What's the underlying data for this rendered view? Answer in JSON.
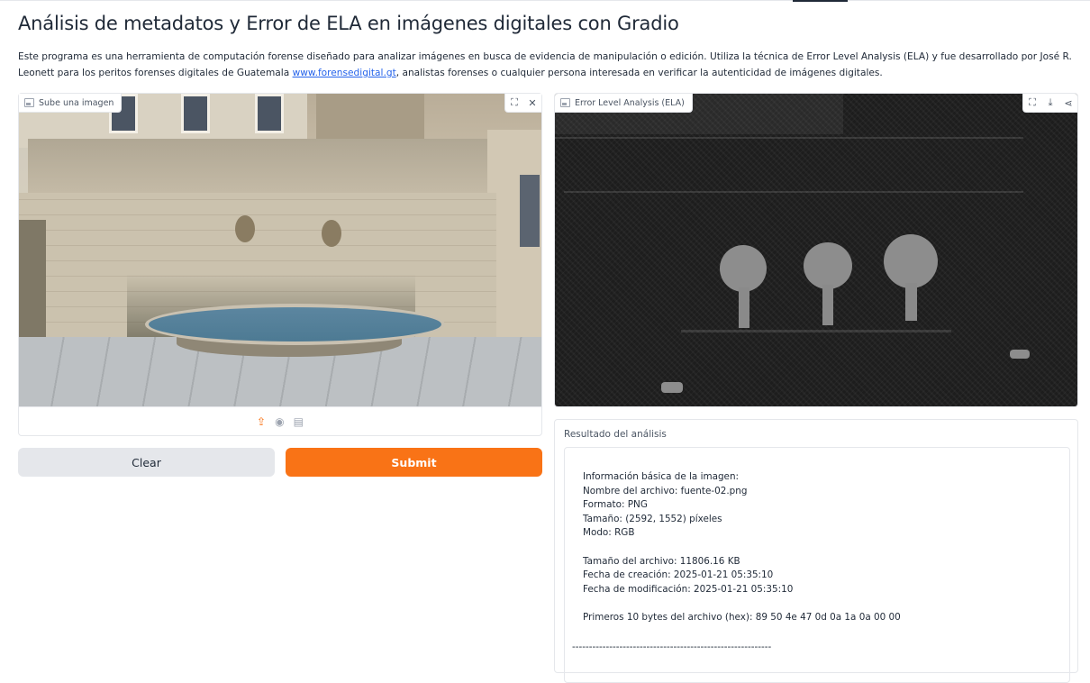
{
  "page": {
    "title": "Análisis de metadatos y Error de ELA en imágenes digitales con Gradio",
    "description_prefix": "Este programa es una herramienta de computación forense diseñado para analizar imágenes en busca de evidencia de manipulación o edición. Utiliza la técnica de Error Level Analysis (ELA) y fue desarrollado por José R. Leonett para los peritos forenses digitales de Guatemala ",
    "description_link": "www.forensedigital.gt",
    "description_suffix": ", analistas forenses o cualquier persona interesada en verificar la autenticidad de imágenes digitales."
  },
  "input_panel": {
    "label": "Sube una imagen",
    "icon": "image-icon",
    "tools": [
      "fullscreen-icon",
      "close-icon"
    ],
    "source_icons": [
      "upload-icon",
      "webcam-icon",
      "clipboard-icon"
    ]
  },
  "ela_panel": {
    "label": "Error Level Analysis (ELA)",
    "icon": "image-icon",
    "tools": [
      "fullscreen-icon",
      "download-icon",
      "share-icon"
    ]
  },
  "buttons": {
    "clear": "Clear",
    "submit": "Submit"
  },
  "colors": {
    "accent": "#f97316",
    "secondary_button": "#e5e7eb",
    "link": "#2563eb"
  },
  "result": {
    "title": "Resultado del análisis",
    "lines": [
      "Información básica de la imagen:",
      "Nombre del archivo: fuente-02.png",
      "Formato: PNG",
      "Tamaño: (2592, 1552) píxeles",
      "Modo: RGB",
      "",
      "Tamaño del archivo: 11806.16 KB",
      "Fecha de creación: 2025-01-21 05:35:10",
      "Fecha de modificación: 2025-01-21 05:35:10",
      "",
      "Primeros 10 bytes del archivo (hex): 89 50 4e 47 0d 0a 1a 0a 00 00"
    ],
    "separator": "-----------------------------------------------------------"
  }
}
